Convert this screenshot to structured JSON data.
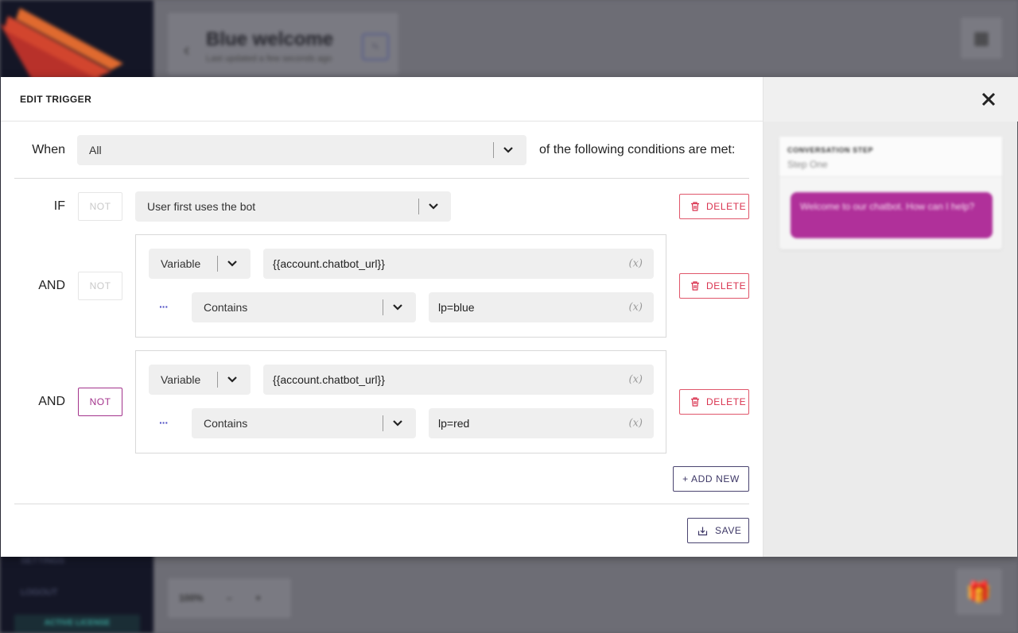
{
  "background": {
    "page_title": "Blue welcome",
    "page_subtitle": "Last updated a few seconds ago",
    "nav_items": [
      "SETTINGS",
      "LOGOUT"
    ],
    "license_badge": "ACTIVE LICENSE",
    "zoom": {
      "level": "100%",
      "minus": "–",
      "plus": "+"
    }
  },
  "modal": {
    "title": "EDIT TRIGGER",
    "when_label": "When",
    "when_select": "All",
    "when_suffix": "of the following conditions are met:",
    "not_label": "NOT",
    "delete_label": "DELETE",
    "add_new_label": "+ ADD NEW",
    "save_label": "SAVE",
    "var_icon": "(x)",
    "more_glyph": "···",
    "conditions": [
      {
        "connector": "IF",
        "not_active": false,
        "event": "User first uses the bot"
      },
      {
        "connector": "AND",
        "not_active": false,
        "type": "Variable",
        "variable": "{{account.chatbot_url}}",
        "operator": "Contains",
        "value": "lp=blue"
      },
      {
        "connector": "AND",
        "not_active": true,
        "type": "Variable",
        "variable": "{{account.chatbot_url}}",
        "operator": "Contains",
        "value": "lp=red"
      }
    ]
  },
  "preview": {
    "card_title": "CONVERSATION STEP",
    "step_name": "Step One",
    "message": "Welcome to our chatbot. How can I help?"
  },
  "colors": {
    "accent": "#a3338c",
    "danger": "#d9334f",
    "primary_outline": "#3d3766"
  }
}
